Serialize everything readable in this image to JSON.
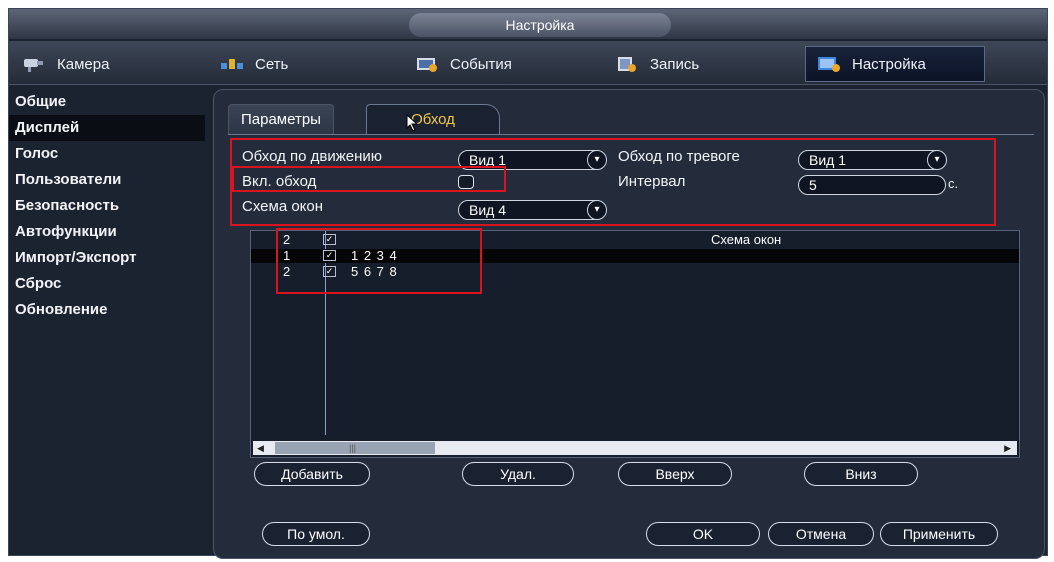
{
  "window": {
    "title": "Настройка"
  },
  "toolbar": {
    "tabs": [
      {
        "label": "Камера",
        "icon": "camera-icon"
      },
      {
        "label": "Сеть",
        "icon": "network-icon"
      },
      {
        "label": "События",
        "icon": "events-icon"
      },
      {
        "label": "Запись",
        "icon": "record-icon"
      },
      {
        "label": "Настройка",
        "icon": "settings-icon",
        "active": true
      }
    ]
  },
  "sidebar": {
    "items": [
      {
        "label": "Общие"
      },
      {
        "label": "Дисплей",
        "active": true
      },
      {
        "label": "Голос"
      },
      {
        "label": "Пользователи"
      },
      {
        "label": "Безопасность"
      },
      {
        "label": "Автофункции"
      },
      {
        "label": "Импорт/Экспорт"
      },
      {
        "label": "Сброс"
      },
      {
        "label": "Обновление"
      }
    ]
  },
  "subtabs": {
    "params": "Параметры",
    "tour": "Обход"
  },
  "form": {
    "motion_tour_label": "Обход по движению",
    "motion_tour_value": "Вид 1",
    "alarm_tour_label": "Обход по тревоге",
    "alarm_tour_value": "Вид 1",
    "enable_tour_label": "Вкл. обход",
    "enable_tour_checked": false,
    "interval_label": "Интервал",
    "interval_value": "5",
    "interval_unit": "с.",
    "layout_label": "Схема окон",
    "layout_value": "Вид 4"
  },
  "grid": {
    "header": {
      "num": "2",
      "title": "Схема окон"
    },
    "rows": [
      {
        "num": "1",
        "checked": true,
        "channels": "1 2 3 4"
      },
      {
        "num": "2",
        "checked": true,
        "channels": "5 6 7 8"
      }
    ]
  },
  "actions": {
    "add": "Добавить",
    "delete": "Удал.",
    "up": "Вверх",
    "down": "Вниз",
    "default": "По умол.",
    "ok": "OK",
    "cancel": "Отмена",
    "apply": "Применить"
  },
  "colors": {
    "highlight": "#d9141f",
    "active_tab_text": "#f1c94a"
  }
}
